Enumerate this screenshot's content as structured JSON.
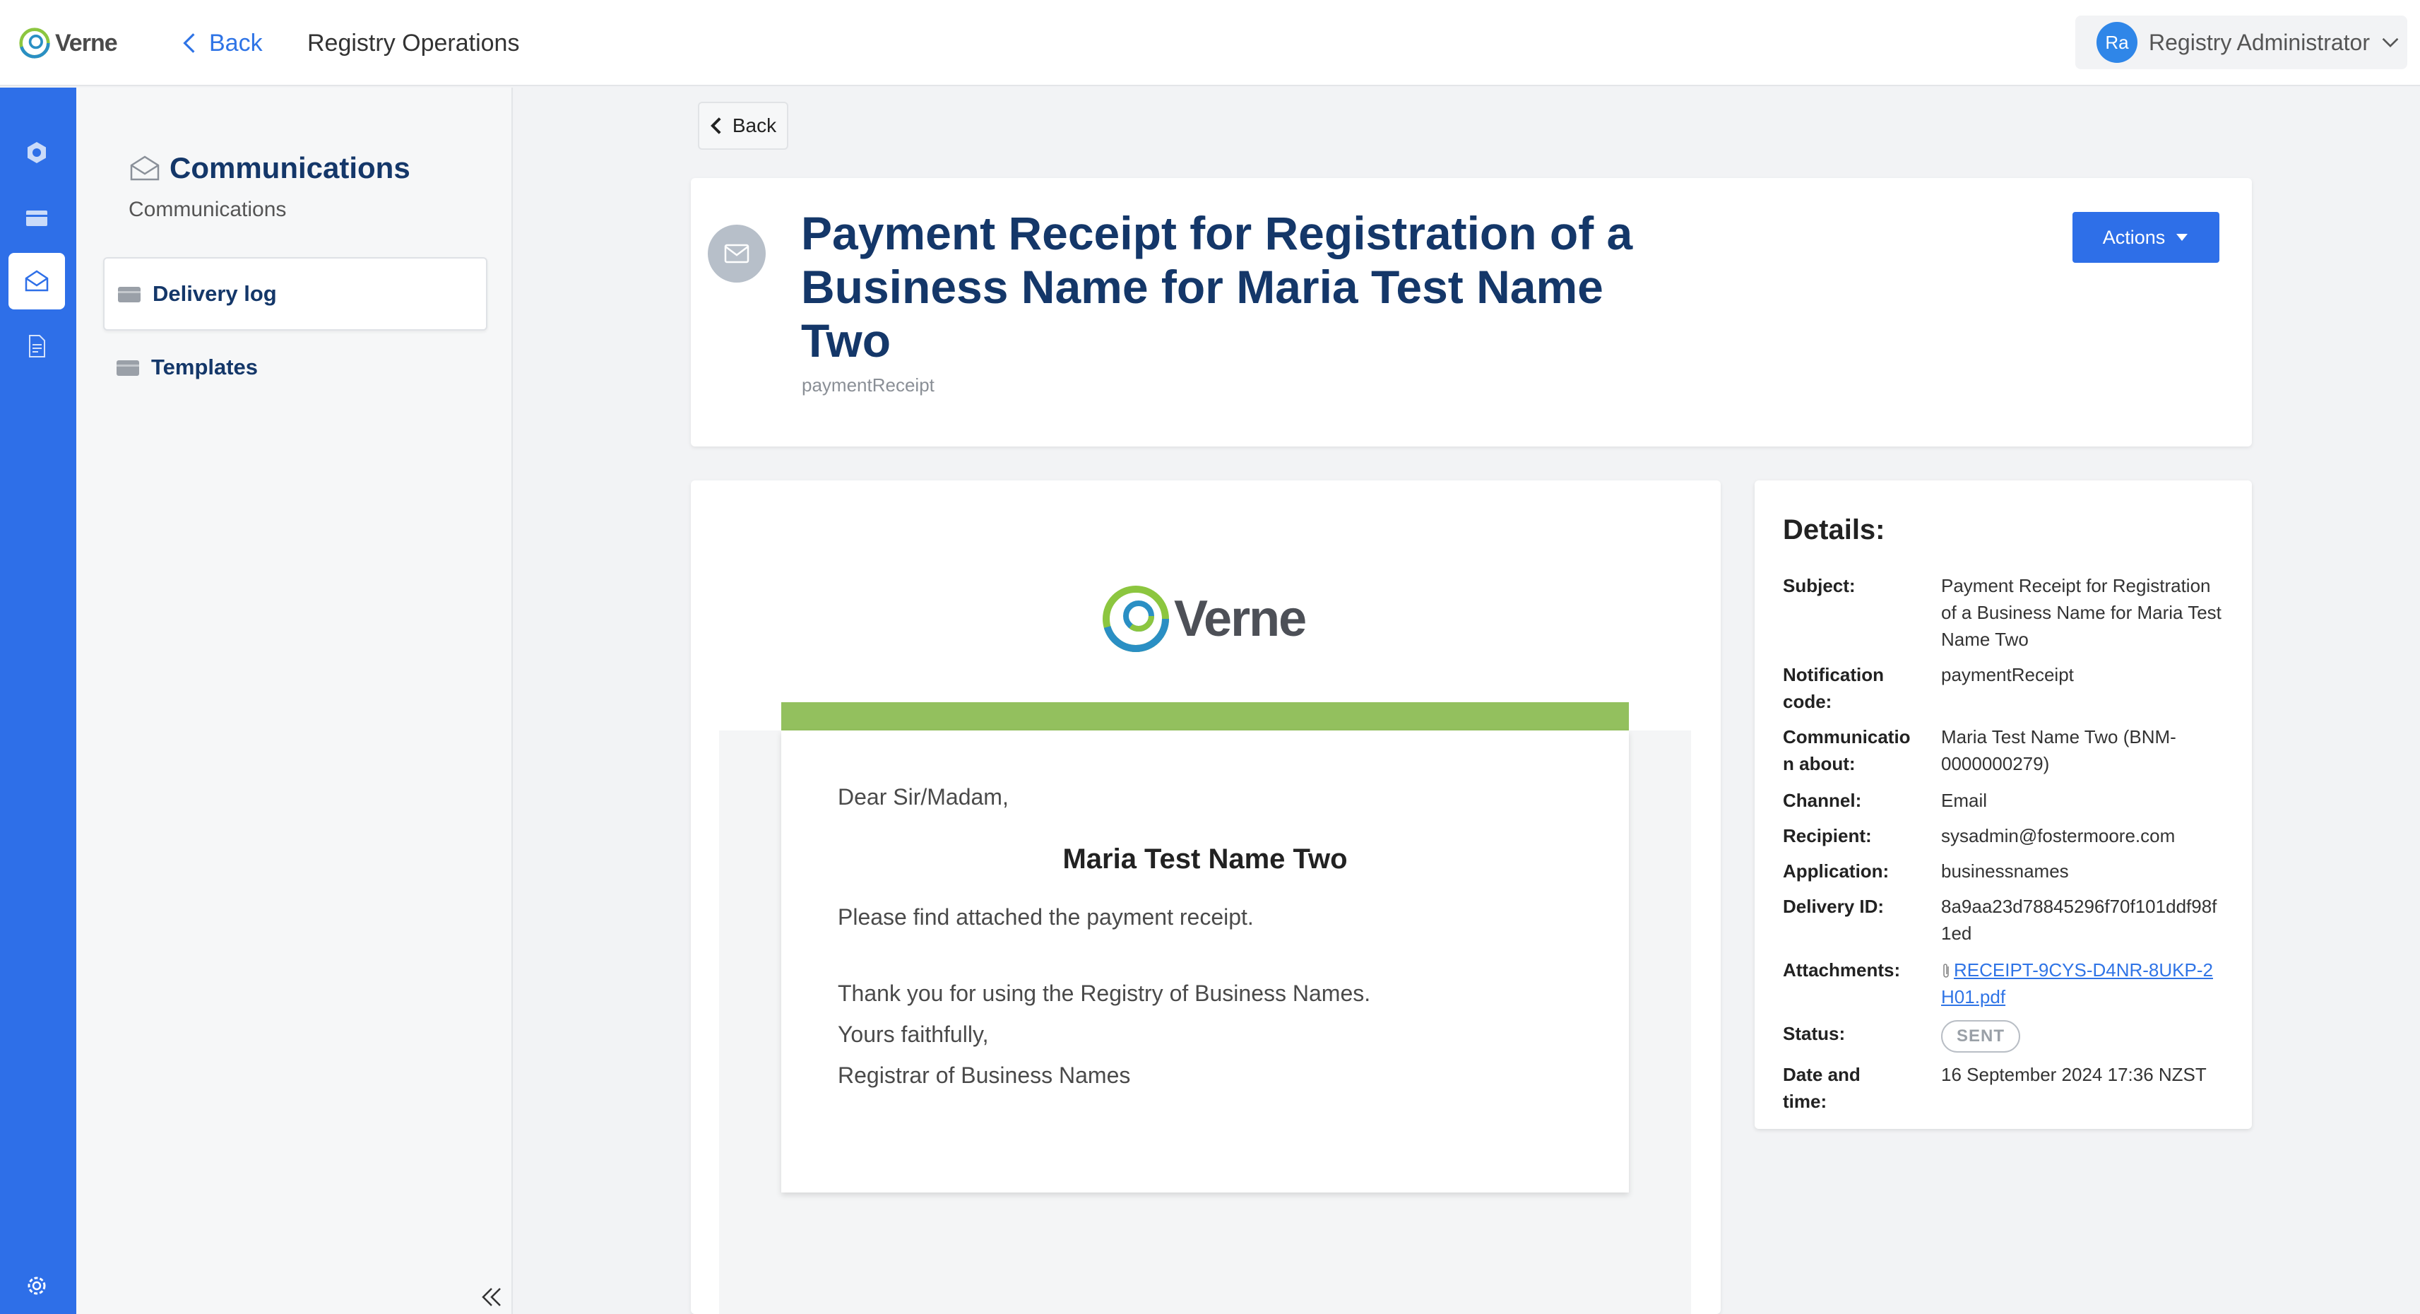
{
  "topbar": {
    "brand": "Verne",
    "back_label": "Back",
    "app_name": "Registry Operations",
    "user": {
      "initials": "Ra",
      "name": "Registry Administrator"
    }
  },
  "rail": {
    "items": [
      {
        "icon": "hexagon-icon",
        "active": false
      },
      {
        "icon": "inbox-icon",
        "active": false
      },
      {
        "icon": "envelope-open-icon",
        "active": true
      },
      {
        "icon": "document-icon",
        "active": false
      }
    ],
    "bottom_icon": "gear-icon"
  },
  "sidebar": {
    "title": "Communications",
    "subtitle": "Communications",
    "items": [
      {
        "label": "Delivery log",
        "active": true
      },
      {
        "label": "Templates",
        "active": false
      }
    ]
  },
  "main": {
    "back_label": "Back",
    "title": "Payment Receipt for Registration of a Business Name for Maria Test Name Two",
    "code": "paymentReceipt",
    "actions_label": "Actions"
  },
  "email": {
    "logo_text": "Verne",
    "greeting": "Dear Sir/Madam,",
    "recipient_name": "Maria Test Name Two",
    "line1": "Please find attached the payment receipt.",
    "line2": "Thank you for using the Registry of Business Names.",
    "line3": "Yours faithfully,",
    "line4": "Registrar of Business Names"
  },
  "details": {
    "title": "Details:",
    "subject_label": "Subject:",
    "subject": "Payment Receipt for Registration of a Business Name for Maria Test Name Two",
    "notification_code_label": "Notification code:",
    "notification_code": "paymentReceipt",
    "communication_about_label": "Communication about:",
    "communication_about": "Maria Test Name Two (BNM-0000000279)",
    "channel_label": "Channel:",
    "channel": "Email",
    "recipient_label": "Recipient:",
    "recipient": "sysadmin@fostermoore.com",
    "application_label": "Application:",
    "application": "businessnames",
    "delivery_id_label": "Delivery ID:",
    "delivery_id": "8a9aa23d78845296f70f101ddf98f1ed",
    "attachments_label": "Attachments:",
    "attachment": "RECEIPT-9CYS-D4NR-8UKP-2H01.pdf",
    "status_label": "Status:",
    "status": "SENT",
    "datetime_label": "Date and time:",
    "datetime": "16 September 2024 17:36 NZST"
  },
  "colors": {
    "primary": "#2e6fe8",
    "title": "#143769",
    "email_bar": "#93c05e"
  }
}
